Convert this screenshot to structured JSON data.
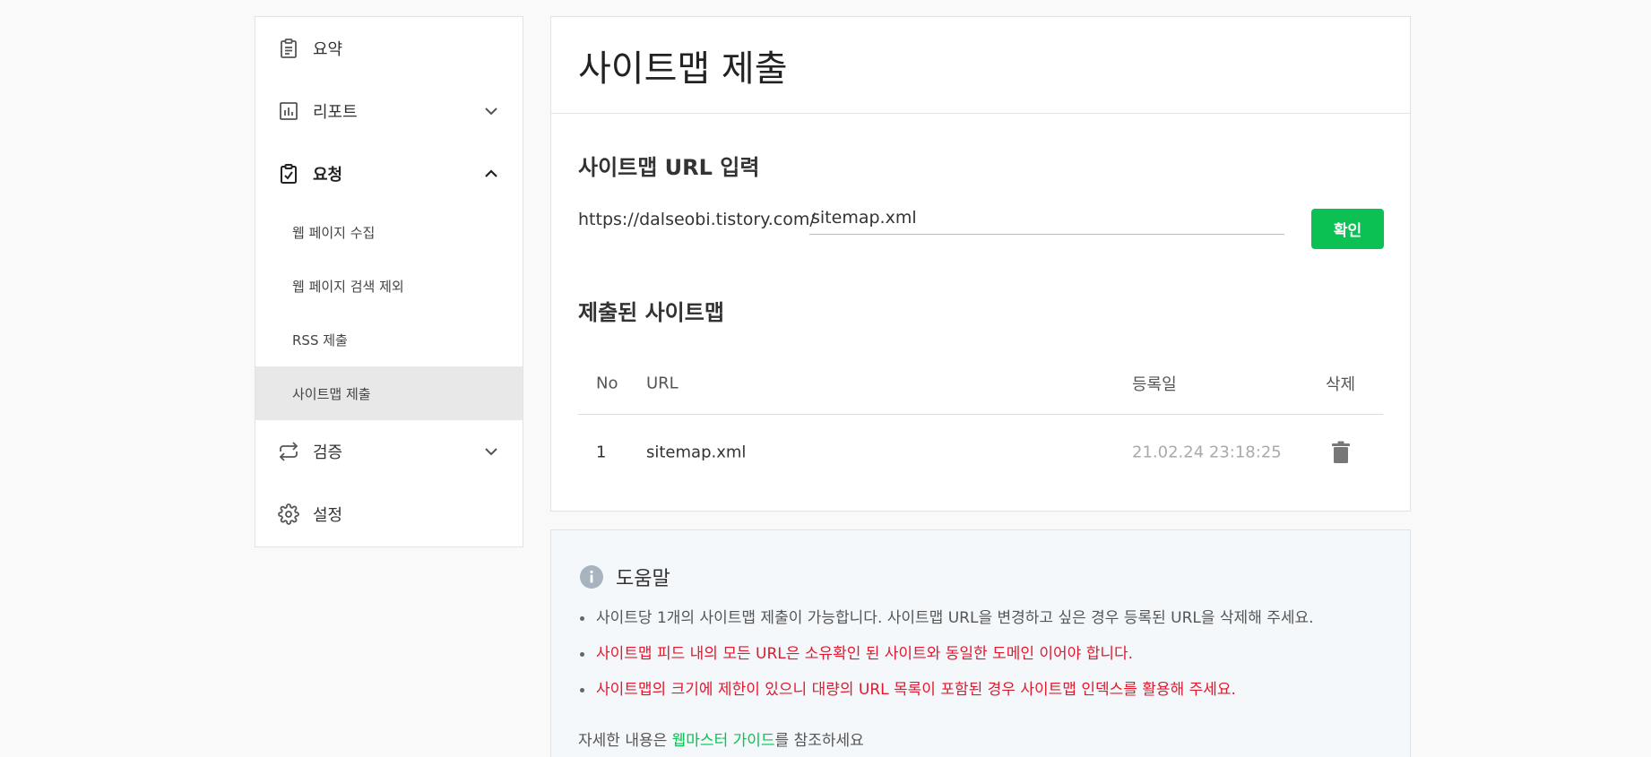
{
  "sidebar": {
    "items": [
      {
        "label": "요약",
        "icon": "clipboard-icon"
      },
      {
        "label": "리포트",
        "icon": "bar-chart-icon"
      },
      {
        "label": "요청",
        "icon": "clipboard-check-icon"
      },
      {
        "label": "검증",
        "icon": "repeat-icon"
      },
      {
        "label": "설정",
        "icon": "gear-icon"
      }
    ],
    "sub_items": [
      {
        "label": "웹 페이지 수집"
      },
      {
        "label": "웹 페이지 검색 제외"
      },
      {
        "label": "RSS 제출"
      },
      {
        "label": "사이트맵 제출"
      }
    ]
  },
  "main": {
    "title": "사이트맵 제출",
    "url_section_title": "사이트맵 URL 입력",
    "url_prefix": "https://dalseobi.tistory.com/",
    "url_value": "sitemap.xml",
    "confirm_label": "확인",
    "submitted_title": "제출된 사이트맵",
    "table": {
      "headers": {
        "no": "No",
        "url": "URL",
        "date": "등록일",
        "delete": "삭제"
      },
      "rows": [
        {
          "no": "1",
          "url": "sitemap.xml",
          "date": "21.02.24 23:18:25"
        }
      ]
    }
  },
  "help": {
    "title": "도움말",
    "items": [
      "사이트당 1개의 사이트맵 제출이 가능합니다. 사이트맵 URL을 변경하고 싶은 경우 등록된 URL을 삭제해 주세요.",
      "사이트맵 피드 내의 모든 URL은 소유확인 된 사이트와 동일한 도메인 이어야 합니다.",
      "사이트맵의 크기에 제한이 있으니 대량의 URL 목록이 포함된 경우 사이트맵 인덱스를 활용해 주세요."
    ],
    "footer_prefix": "자세한 내용은 ",
    "footer_link": "웹마스터 가이드",
    "footer_suffix": "를 참조하세요"
  },
  "colors": {
    "accent": "#0cc153",
    "warning": "#e0192e"
  }
}
